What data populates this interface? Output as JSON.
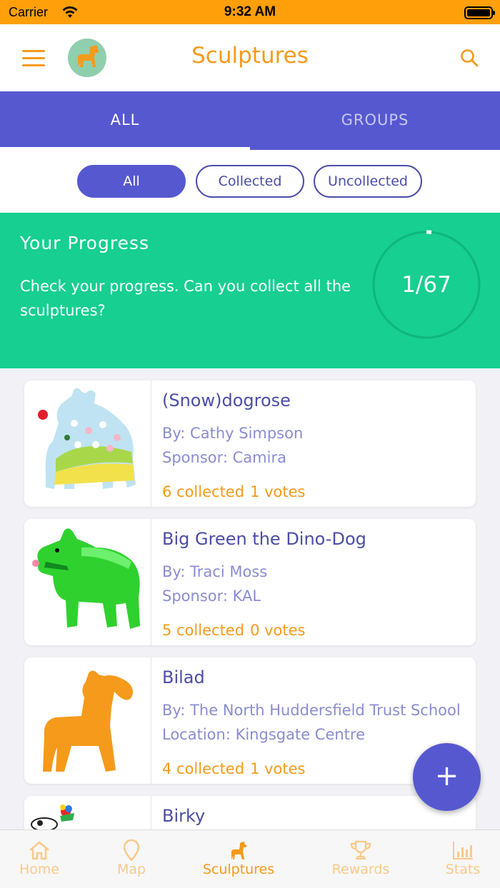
{
  "status_bar": {
    "carrier": "Carrier",
    "time": "9:32 AM"
  },
  "nav": {
    "title": "Sculptures",
    "menu_icon": "hamburger-icon",
    "search_icon": "search-icon"
  },
  "tabs": [
    {
      "label": "ALL",
      "active": true
    },
    {
      "label": "GROUPS",
      "active": false
    }
  ],
  "filters": [
    {
      "label": "All",
      "active": true
    },
    {
      "label": "Collected",
      "active": false
    },
    {
      "label": "Uncollected",
      "active": false
    }
  ],
  "progress": {
    "title": "Your Progress",
    "text": "Check your progress. Can you collect all the sculptures?",
    "count": "1/67",
    "fraction": 0.015
  },
  "sculptures": [
    {
      "title": "(Snow)dogrose",
      "line1": "By: Cathy Simpson",
      "line2": "Sponsor: Camira",
      "collected": "6 collected",
      "votes": "1 votes"
    },
    {
      "title": "Big Green the Dino-Dog",
      "line1": "By: Traci Moss",
      "line2": "Sponsor: KAL",
      "collected": "5 collected",
      "votes": "0 votes"
    },
    {
      "title": "Bilad",
      "line1": "By: The North Huddersfield Trust School",
      "line2": "Location: Kingsgate Centre",
      "collected": "4 collected",
      "votes": "1 votes"
    },
    {
      "title": "Birky",
      "line1": "",
      "line2": "",
      "collected": "",
      "votes": ""
    }
  ],
  "fab": {
    "label": "+"
  },
  "bottom_nav": [
    {
      "label": "Home",
      "icon": "home-icon",
      "active": false
    },
    {
      "label": "Map",
      "icon": "map-pin-icon",
      "active": false
    },
    {
      "label": "Sculptures",
      "icon": "dog-icon",
      "active": true
    },
    {
      "label": "Rewards",
      "icon": "trophy-icon",
      "active": false
    },
    {
      "label": "Stats",
      "icon": "bar-chart-icon",
      "active": false
    }
  ],
  "colors": {
    "accent": "#f59a1b",
    "primary": "#5658d0",
    "progress_bg": "#16cf90",
    "status_bar": "#ff9f0a"
  }
}
